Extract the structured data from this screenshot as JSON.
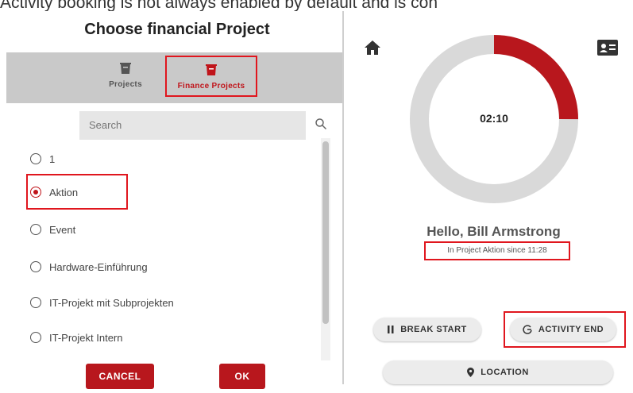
{
  "caption": "Activity booking is not always enabled by default and is con",
  "dialog": {
    "title": "Choose financial Project",
    "tabs": [
      {
        "label": "Projects",
        "icon": "bucket-icon",
        "active": false
      },
      {
        "label": "Finance Projects",
        "icon": "bucket-icon",
        "active": true
      }
    ],
    "search_placeholder": "Search",
    "items": [
      {
        "label": "1",
        "checked": false
      },
      {
        "label": "Aktion",
        "checked": true
      },
      {
        "label": "Event",
        "checked": false
      },
      {
        "label": "Hardware-Einführung",
        "checked": false
      },
      {
        "label": "IT-Projekt mit Subprojekten",
        "checked": false
      },
      {
        "label": "IT-Projekt Intern",
        "checked": false
      }
    ],
    "cancel_label": "CANCEL",
    "ok_label": "OK"
  },
  "tracker": {
    "timer": "02:10",
    "progress_fraction": 0.25,
    "greeting": "Hello, Bill Armstrong",
    "status": "In Project Aktion since 11:28",
    "break_label": "BREAK START",
    "activity_label": "ACTIVITY END",
    "location_label": "LOCATION",
    "icons": [
      "home-icon",
      "id-card-icon",
      "pause-icon",
      "activity-end-icon",
      "location-pin-icon"
    ]
  },
  "colors": {
    "accent": "#b8171d",
    "highlight": "#e0161e",
    "ring_track": "#d9d9d9",
    "tab_bar": "#c9c9c9"
  }
}
